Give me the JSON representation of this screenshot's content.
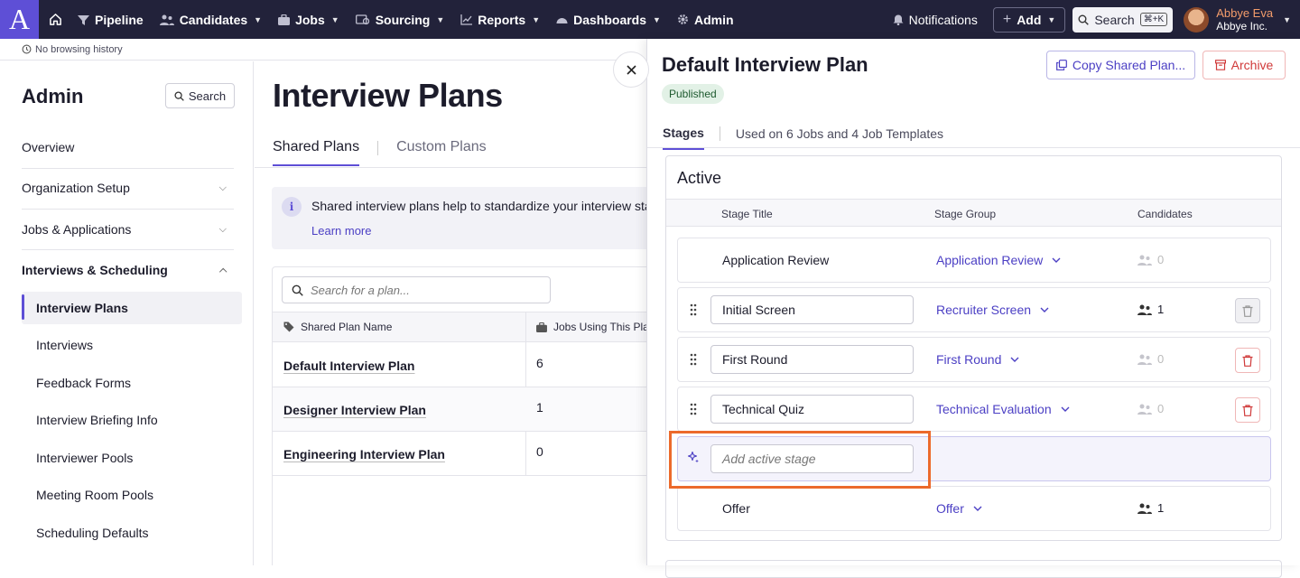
{
  "nav": {
    "logo": "A",
    "items": [
      {
        "label": "Pipeline",
        "icon": "filter-icon"
      },
      {
        "label": "Candidates",
        "icon": "people-icon"
      },
      {
        "label": "Jobs",
        "icon": "briefcase-icon"
      },
      {
        "label": "Sourcing",
        "icon": "sourcing-icon"
      },
      {
        "label": "Reports",
        "icon": "chart-icon"
      },
      {
        "label": "Dashboards",
        "icon": "gauge-icon"
      },
      {
        "label": "Admin",
        "icon": "gear-icon"
      }
    ],
    "notifications": "Notifications",
    "add": "Add",
    "search": "Search",
    "shortcut": "⌘+K",
    "user_name": "Abbye Eva",
    "user_org": "Abbye Inc."
  },
  "subbar": {
    "history": "No browsing history"
  },
  "sidebar": {
    "title": "Admin",
    "search": "Search",
    "sections": [
      {
        "label": "Overview"
      },
      {
        "label": "Organization Setup"
      },
      {
        "label": "Jobs & Applications"
      },
      {
        "label": "Interviews & Scheduling"
      }
    ],
    "sub_items": [
      {
        "label": "Interview Plans"
      },
      {
        "label": "Interviews"
      },
      {
        "label": "Feedback Forms"
      },
      {
        "label": "Interview Briefing Info"
      },
      {
        "label": "Interviewer Pools"
      },
      {
        "label": "Meeting Room Pools"
      },
      {
        "label": "Scheduling Defaults"
      }
    ]
  },
  "main": {
    "title": "Interview Plans",
    "tabs": [
      {
        "label": "Shared Plans"
      },
      {
        "label": "Custom Plans"
      }
    ],
    "info_text": "Shared interview plans help to standardize your interview stages",
    "info_link": "Learn more",
    "search_placeholder": "Search for a plan...",
    "columns": [
      "Shared Plan Name",
      "Jobs Using This Plan"
    ],
    "rows": [
      {
        "name": "Default Interview Plan",
        "jobs": "6"
      },
      {
        "name": "Designer Interview Plan",
        "jobs": "1"
      },
      {
        "name": "Engineering Interview Plan",
        "jobs": "0"
      }
    ]
  },
  "drawer": {
    "title": "Default Interview Plan",
    "status": "Published",
    "copy_button": "Copy Shared Plan...",
    "archive_button": "Archive",
    "tab_stages": "Stages",
    "usage": "Used on 6 Jobs and 4 Job Templates",
    "section_title": "Active",
    "columns": [
      "Stage Title",
      "Stage Group",
      "Candidates"
    ],
    "stages": [
      {
        "title": "Application Review",
        "group": "Application Review",
        "candidates": "0"
      },
      {
        "title": "Initial Screen",
        "group": "Recruiter Screen",
        "candidates": "1"
      },
      {
        "title": "First Round",
        "group": "First Round",
        "candidates": "0"
      },
      {
        "title": "Technical Quiz",
        "group": "Technical Evaluation",
        "candidates": "0"
      },
      {
        "title": "Offer",
        "group": "Offer",
        "candidates": "1"
      }
    ],
    "add_placeholder": "Add active stage"
  },
  "colors": {
    "accent": "#5e4fd6",
    "nav_bg": "#22223a",
    "highlight": "#ec6a2c",
    "danger": "#d03a3a"
  }
}
